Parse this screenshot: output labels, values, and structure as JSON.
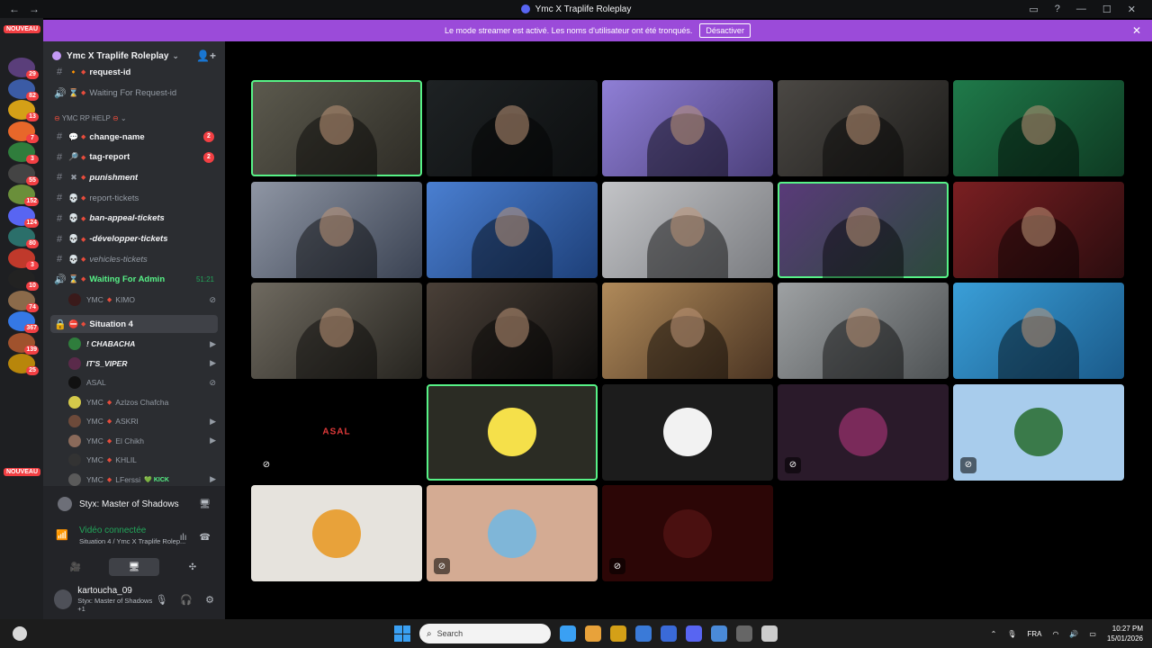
{
  "window": {
    "title": "Ymc X Traplife Roleplay",
    "nav_back": "←",
    "nav_forward": "→",
    "controls": [
      "▭",
      "?",
      "—",
      "☐",
      "✕"
    ]
  },
  "banner": {
    "text": "Le mode streamer est activé. Les noms d'utilisateur ont été tronqués.",
    "button": "Désactiver",
    "close": "✕"
  },
  "guilds": {
    "new_label_top": "NOUVEAU",
    "new_label_bottom": "NOUVEAU",
    "icons": [
      {
        "badge": "29",
        "color": "#5a3e7a"
      },
      {
        "badge": "82",
        "color": "#3b5ba5"
      },
      {
        "badge": "13",
        "color": "#d4a017"
      },
      {
        "badge": "7",
        "color": "#e8672a"
      },
      {
        "badge": "3",
        "color": "#2f7d3c"
      },
      {
        "badge": "55",
        "color": "#444"
      },
      {
        "badge": "152",
        "color": "#6a8f3a"
      },
      {
        "badge": "124",
        "color": "#5865f2"
      },
      {
        "badge": "80",
        "color": "#2b6f6a"
      },
      {
        "badge": "3",
        "color": "#c0392b"
      },
      {
        "badge": "10",
        "color": "#222"
      },
      {
        "badge": "74",
        "color": "#8b6a4a"
      },
      {
        "badge": "367",
        "color": "#3578e5"
      },
      {
        "badge": "139",
        "color": "#a0522d"
      },
      {
        "badge": "25",
        "color": "#b8860b"
      }
    ]
  },
  "server": {
    "name": "Ymc X Traplife Roleplay",
    "chevron": "⌄",
    "invite_icon": "👤+"
  },
  "channels": {
    "partial_top": "request-id",
    "waiting_request": "Waiting For Request-id",
    "category": "YMC RP HELP",
    "items": [
      {
        "emoji": "💬",
        "name": "change-name",
        "badge": "2",
        "bold": true,
        "italic": false
      },
      {
        "emoji": "🔎",
        "name": "tag-report",
        "badge": "2",
        "bold": true,
        "italic": false
      },
      {
        "emoji": "✖",
        "name": "punishment",
        "badge": "",
        "bold": true,
        "italic": true
      },
      {
        "emoji": "💀",
        "name": "report-tickets",
        "badge": "",
        "bold": false,
        "italic": false
      },
      {
        "emoji": "💀",
        "name": "ban-appeal-tickets",
        "badge": "",
        "bold": true,
        "italic": true
      },
      {
        "emoji": "💀",
        "name": "-développer-tickets",
        "badge": "",
        "bold": true,
        "italic": true
      },
      {
        "emoji": "💀",
        "name": "vehicles-tickets",
        "badge": "",
        "bold": false,
        "italic": true
      }
    ],
    "waiting_admin": {
      "name": "Waiting For Admin",
      "time": "51:21"
    },
    "waiting_member": {
      "prefix": "YMC",
      "name": "KIMO"
    },
    "situation": "Situation 4",
    "voice_members": [
      {
        "name": "! CHABACHA",
        "prefix": "",
        "icon": "▶",
        "avatar": "#2f7d3c"
      },
      {
        "name": "IT'S_VIPER",
        "prefix": "",
        "icon": "▶",
        "avatar": "#5a2a4a"
      },
      {
        "name": "ASAL",
        "prefix": "",
        "icon": "⊘",
        "avatar": "#111"
      },
      {
        "name": "Azlzos Chafcha",
        "prefix": "YMC",
        "icon": "",
        "avatar": "#d4c94a"
      },
      {
        "name": "ASKRI",
        "prefix": "YMC",
        "icon": "▶",
        "avatar": "#6d4a3a"
      },
      {
        "name": "El Chikh",
        "prefix": "YMC",
        "icon": "▶",
        "avatar": "#8a6a5a"
      },
      {
        "name": "KHLIL",
        "prefix": "YMC",
        "icon": "",
        "avatar": "#333"
      },
      {
        "name": "LFerssi",
        "prefix": "YMC",
        "suffix": "💚 KICK",
        "icon": "▶",
        "avatar": "#5a5a5a"
      }
    ]
  },
  "user_panel": {
    "activity": "Styx: Master of Shadows",
    "voice_status": "Vidéo connectée",
    "voice_channel": "Situation 4 / Ymc X Traplife Rolep...",
    "username": "kartoucha_09",
    "user_activity": "Styx: Master of Shadows +1",
    "icons": {
      "mic": "🎙",
      "headset": "🎧",
      "settings": "⚙",
      "camera": "🎥",
      "screen": "🖥",
      "activities": "✣",
      "noise": "ılı",
      "disconnect": "☎"
    }
  },
  "tiles": [
    {
      "type": "video",
      "bg": "linear-gradient(135deg,#5c5a4e,#2d2b25)",
      "selected": true
    },
    {
      "type": "video",
      "bg": "linear-gradient(135deg,#1e2224,#0c0e0f)",
      "selected": false
    },
    {
      "type": "video",
      "bg": "linear-gradient(135deg,#8f7fd6,#4b3f7a)",
      "selected": false
    },
    {
      "type": "video",
      "bg": "linear-gradient(135deg,#4b4844,#1d1c1a)",
      "selected": false
    },
    {
      "type": "video",
      "bg": "linear-gradient(135deg,#1f7a4a,#0e3a22)",
      "selected": false
    },
    {
      "type": "video",
      "bg": "linear-gradient(135deg,#8f96a4,#3a4252)",
      "selected": false
    },
    {
      "type": "video",
      "bg": "linear-gradient(135deg,#4a7fd1,#1d3f78)",
      "selected": false
    },
    {
      "type": "video",
      "bg": "linear-gradient(135deg,#c3c4c7,#7a7c80)",
      "selected": false
    },
    {
      "type": "video",
      "bg": "linear-gradient(135deg,#5a3a7a,#2a4a3a)",
      "selected": true
    },
    {
      "type": "video",
      "bg": "linear-gradient(135deg,#7a1f22,#2a0c0e)",
      "selected": false
    },
    {
      "type": "video",
      "bg": "linear-gradient(135deg,#6f6a60,#26241f)",
      "selected": false
    },
    {
      "type": "video",
      "bg": "linear-gradient(135deg,#4a4038,#0e0d0c)",
      "selected": false
    },
    {
      "type": "video",
      "bg": "linear-gradient(135deg,#b08a5a,#4a3422)",
      "selected": false
    },
    {
      "type": "video",
      "bg": "linear-gradient(135deg,#9ea1a3,#4e5254)",
      "selected": false
    },
    {
      "type": "video",
      "bg": "linear-gradient(135deg,#3a9fd8,#1a5a8a)",
      "selected": false
    },
    {
      "type": "label",
      "bg": "#000",
      "label": "ASAL",
      "muted": true
    },
    {
      "type": "avatar",
      "bg": "#2b2c24",
      "avatar": "#f5e04a",
      "selected": true,
      "muted": false
    },
    {
      "type": "avatar",
      "bg": "#1c1c1c",
      "avatar": "#f2f2f2",
      "muted": false
    },
    {
      "type": "avatar",
      "bg": "#2a1a2a",
      "avatar": "#7a2a5a",
      "muted": true
    },
    {
      "type": "avatar",
      "bg": "#a8ccec",
      "avatar": "#3a7a4a",
      "muted": true
    },
    {
      "type": "avatar",
      "bg": "#e6e3dd",
      "avatar": "#e8a23a",
      "muted": false
    },
    {
      "type": "avatar",
      "bg": "#d4ab93",
      "avatar": "#7fb6d8",
      "muted": true
    },
    {
      "type": "avatar",
      "bg": "#2c0606",
      "avatar": "#4a1010",
      "muted": true
    }
  ],
  "taskbar": {
    "search_placeholder": "Search",
    "lang": "FRA",
    "time": "10:27 PM",
    "date": "15/01/2026",
    "apps": [
      "#3aa0f3",
      "#e8a23a",
      "#d4a017",
      "#3a7ad8",
      "#3a6ad8",
      "#5865f2",
      "#4a8ad8",
      "#666",
      "#ccc"
    ]
  }
}
